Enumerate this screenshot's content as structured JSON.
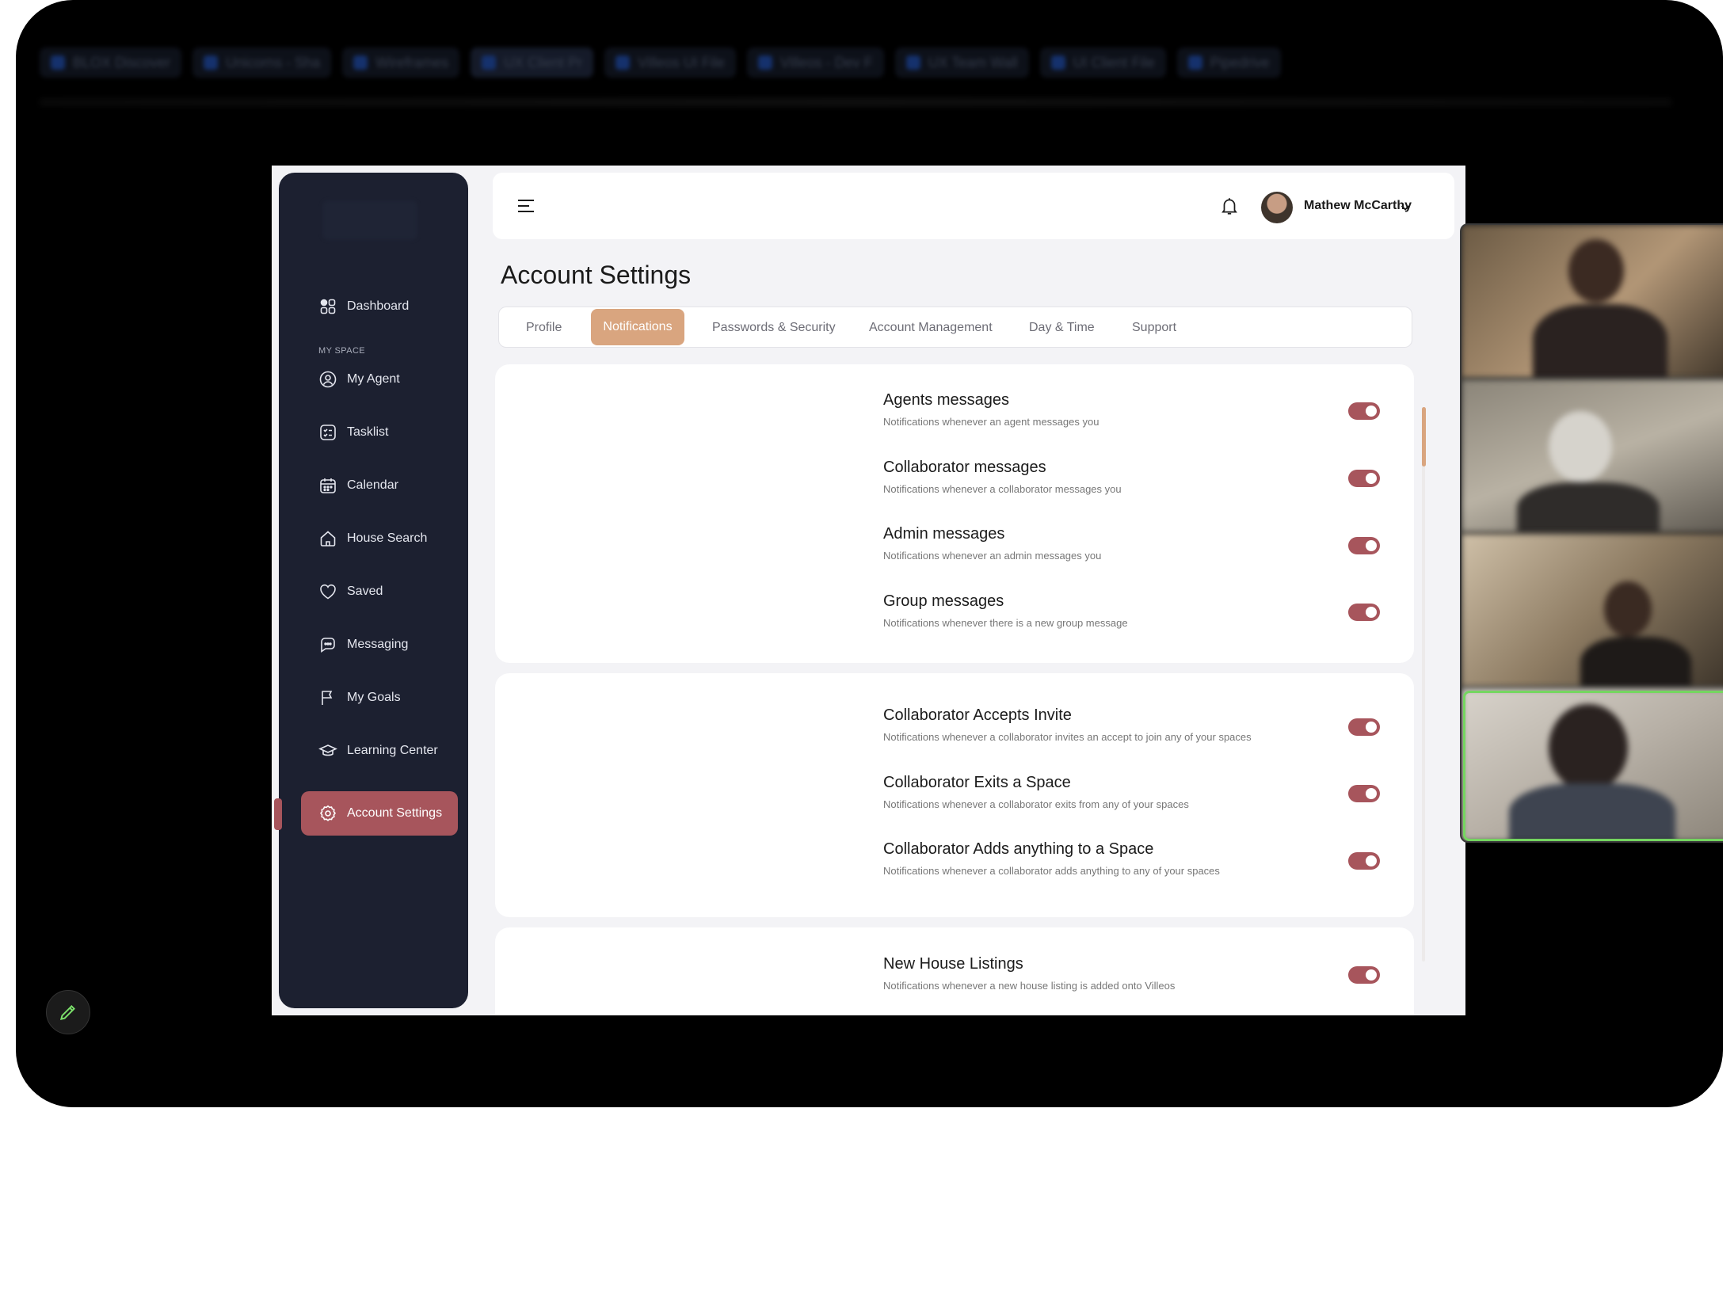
{
  "browser_tabs": [
    "BLOX Discover",
    "Unicorns - Sha",
    "Wireframes",
    "UX Client Pr",
    "Villeos UI File",
    "Villeos - Dev F",
    "UX Team Wall",
    "UI Client File",
    "Pipedrive"
  ],
  "sidebar": {
    "dashboard": "Dashboard",
    "section_label": "MY SPACE",
    "items": [
      "My Agent",
      "Tasklist",
      "Calendar",
      "House Search",
      "Saved",
      "Messaging",
      "My Goals",
      "Learning Center"
    ],
    "active": "Account Settings"
  },
  "topbar": {
    "user_name": "Mathew McCarthy"
  },
  "page": {
    "title": "Account Settings",
    "tabs": [
      "Profile",
      "Notifications",
      "Passwords & Security",
      "Account Management",
      "Day & Time",
      "Support"
    ],
    "active_tab": "Notifications"
  },
  "notifications": {
    "group1": [
      {
        "title": "Agents messages",
        "desc": "Notifications whenever an agent messages you",
        "enabled": true
      },
      {
        "title": "Collaborator messages",
        "desc": "Notifications whenever a collaborator messages you",
        "enabled": true
      },
      {
        "title": "Admin messages",
        "desc": "Notifications whenever an admin messages you",
        "enabled": true
      },
      {
        "title": "Group messages",
        "desc": "Notifications whenever there is a new group message",
        "enabled": true
      }
    ],
    "group2": [
      {
        "title": "Collaborator Accepts Invite",
        "desc": "Notifications whenever a collaborator invites an accept to join any of your spaces",
        "enabled": true
      },
      {
        "title": "Collaborator Exits a Space",
        "desc": "Notifications whenever a collaborator exits from any of your spaces",
        "enabled": true
      },
      {
        "title": "Collaborator Adds anything to a Space",
        "desc": "Notifications whenever a collaborator adds anything to any of your spaces",
        "enabled": true
      }
    ],
    "group3": [
      {
        "title": "New House Listings",
        "desc": "Notifications whenever a new house listing is added onto Villeos",
        "enabled": true
      }
    ]
  },
  "colors": {
    "accent": "#a7555c",
    "tab_active": "#d9a57f",
    "sidebar": "#1c2030"
  },
  "icons": [
    "dashboard-icon",
    "agent-icon",
    "tasklist-icon",
    "calendar-icon",
    "house-icon",
    "heart-icon",
    "messaging-icon",
    "flag-icon",
    "learning-icon",
    "gear-icon",
    "bell-icon",
    "hamburger-icon",
    "chevron-down-icon",
    "pencil-icon"
  ]
}
